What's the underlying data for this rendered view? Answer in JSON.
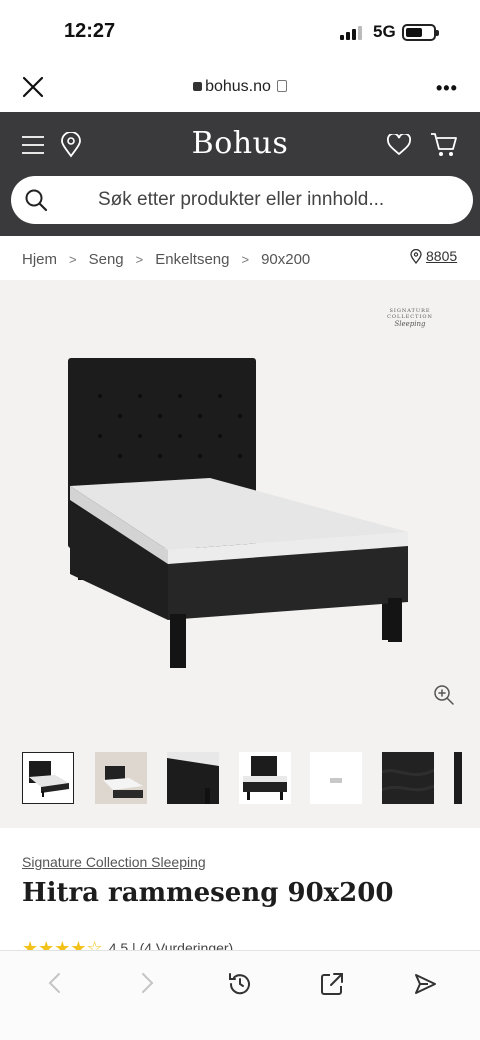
{
  "status_bar": {
    "time": "12:27",
    "network": "5G"
  },
  "browser": {
    "url": "bohus.no"
  },
  "site": {
    "logo": "Bohus",
    "search_placeholder": "Søk etter produkter eller innhold..."
  },
  "breadcrumb": {
    "items": [
      "Hjem",
      "Seng",
      "Enkeltseng",
      "90x200"
    ],
    "store_number": "8805"
  },
  "gallery": {
    "brand_mark_line1": "SIGNATURE COLLECTION",
    "brand_mark_line2": "Sleeping",
    "thumbnail_count": 7,
    "selected_index": 0
  },
  "product": {
    "brand": "Signature Collection Sleeping",
    "title": "Hitra rammeseng 90x200",
    "rating_value": "4,5",
    "rating_text": "(4 Vurderinger)",
    "rating_stars": 4.5
  },
  "colors": {
    "header_bg": "#3a3a3c",
    "hero_bg": "#f3f2f0",
    "star": "#f2c21b"
  }
}
